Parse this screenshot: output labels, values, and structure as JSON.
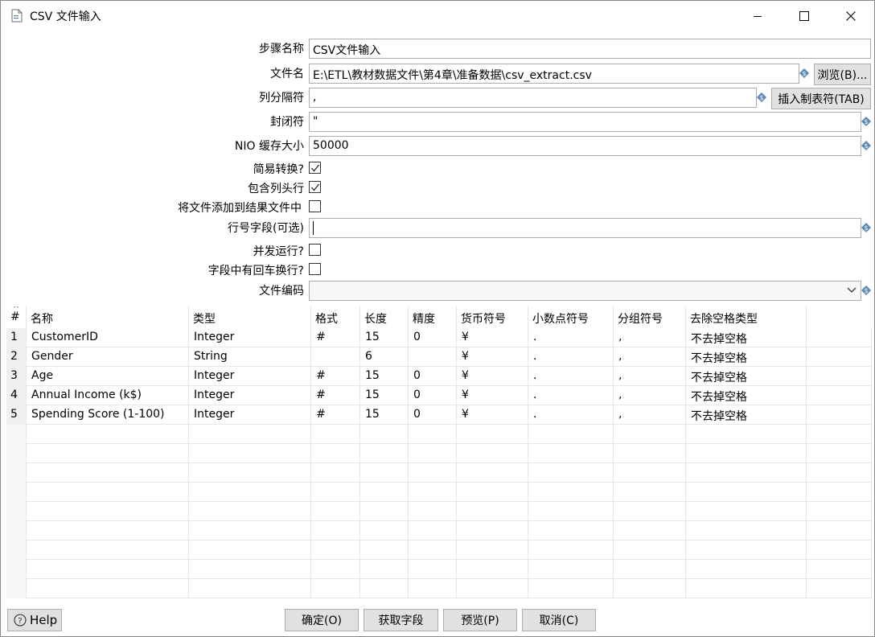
{
  "window": {
    "title": "CSV 文件输入",
    "controls": {
      "minimize": "minimize-icon",
      "maximize": "maximize-icon",
      "close": "close-icon"
    }
  },
  "form": {
    "step_name": {
      "label": "步骤名称",
      "value": "CSV文件输入"
    },
    "filename": {
      "label": "文件名",
      "value": "E:\\ETL\\教材数据文件\\第4章\\准备数据\\csv_extract.csv",
      "browse": "浏览(B)..."
    },
    "delimiter": {
      "label": "列分隔符",
      "value": ",",
      "insert_tab": "插入制表符(TAB)"
    },
    "enclosure": {
      "label": "封闭符",
      "value": "\""
    },
    "nio_buffer": {
      "label": "NIO 缓存大小",
      "value": "50000"
    },
    "lazy_conversion": {
      "label": "简易转换?",
      "checked": true
    },
    "header_row": {
      "label": "包含列头行",
      "checked": true
    },
    "add_to_result": {
      "label": "将文件添加到结果文件中",
      "checked": false
    },
    "row_num_field": {
      "label": "行号字段(可选)",
      "value": ""
    },
    "parallel": {
      "label": "并发运行?",
      "checked": false
    },
    "newline_in_field": {
      "label": "字段中有回车换行?",
      "checked": false
    },
    "encoding": {
      "label": "文件编码",
      "value": ""
    }
  },
  "table": {
    "sort_indicator": "^",
    "columns": [
      "#",
      "名称",
      "类型",
      "格式",
      "长度",
      "精度",
      "货币符号",
      "小数点符号",
      "分组符号",
      "去除空格类型"
    ],
    "rows": [
      [
        "1",
        "CustomerID",
        "Integer",
        "#",
        "15",
        "0",
        "¥",
        ".",
        ",",
        "不去掉空格"
      ],
      [
        "2",
        "Gender",
        "String",
        "",
        "6",
        "",
        "¥",
        ".",
        ",",
        "不去掉空格"
      ],
      [
        "3",
        "Age",
        "Integer",
        "#",
        "15",
        "0",
        "¥",
        ".",
        ",",
        "不去掉空格"
      ],
      [
        "4",
        "Annual Income (k$)",
        "Integer",
        "#",
        "15",
        "0",
        "¥",
        ".",
        ",",
        "不去掉空格"
      ],
      [
        "5",
        "Spending Score (1-100)",
        "Integer",
        "#",
        "15",
        "0",
        "¥",
        ".",
        ",",
        "不去掉空格"
      ]
    ]
  },
  "buttons": {
    "help": "Help",
    "ok": "确定(O)",
    "get_fields": "获取字段",
    "preview": "预览(P)",
    "cancel": "取消(C)"
  },
  "colors": {
    "button_bg": "#e1e1e1",
    "border": "#adadad",
    "variable_icon": "#5b86b6"
  }
}
